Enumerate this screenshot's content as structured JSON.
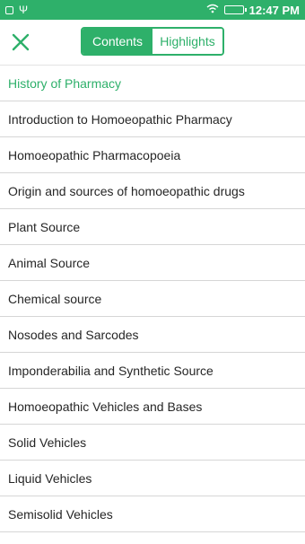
{
  "status_bar": {
    "time": "12:47",
    "time_suffix": "PM",
    "icons": [
      "screen-icon",
      "usb-icon",
      "wifi-icon",
      "battery-icon"
    ],
    "color": "#2eb06a"
  },
  "toolbar": {
    "close_icon": "close-icon",
    "tabs": [
      {
        "label": "Contents",
        "active": true
      },
      {
        "label": "Highlights",
        "active": false
      }
    ],
    "accent": "#2eb06a"
  },
  "toc": {
    "items": [
      "History of Pharmacy",
      "Introduction to Homoeopathic Pharmacy",
      "Homoeopathic Pharmacopoeia",
      "Origin and sources of homoeopathic drugs",
      "Plant Source",
      "Animal Source",
      "Chemical source",
      "Nosodes and Sarcodes",
      "Imponderabilia and Synthetic Source",
      "Homoeopathic Vehicles and Bases",
      "Solid Vehicles",
      "Liquid Vehicles",
      "Semisolid Vehicles"
    ],
    "selected_index": 0
  }
}
